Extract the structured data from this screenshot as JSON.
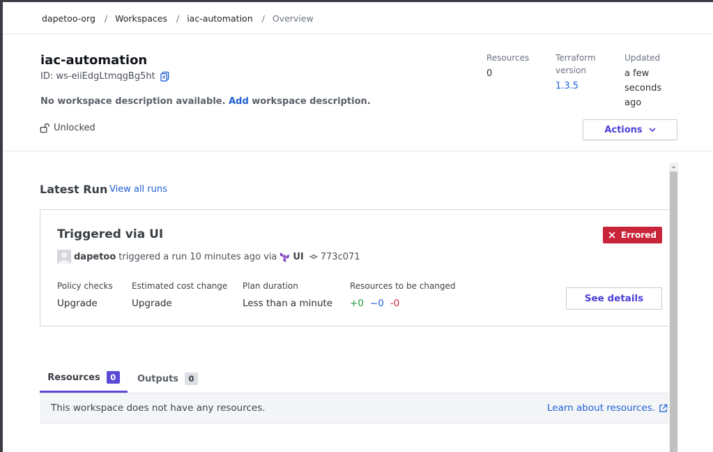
{
  "breadcrumb": {
    "org": "dapetoo-org",
    "workspaces": "Workspaces",
    "workspace": "iac-automation",
    "current": "Overview",
    "separator": "/"
  },
  "header": {
    "title": "iac-automation",
    "id_text": "ID: ws-eiiEdgLtmqgBg5ht",
    "description_prefix": "No workspace description available.",
    "description_link": "Add",
    "description_suffix": "workspace description.",
    "lock_status": "Unlocked",
    "actions_label": "Actions"
  },
  "stats": {
    "resources_label": "Resources",
    "resources_value": "0",
    "terraform_label_line1": "Terraform",
    "terraform_label_line2": "version",
    "terraform_value": "1.3.5",
    "updated_label": "Updated",
    "updated_line1": "a few",
    "updated_line2": "seconds",
    "updated_line3": "ago"
  },
  "latest_run": {
    "section_title": "Latest Run",
    "view_all": "View all runs",
    "run_title": "Triggered via UI",
    "status": "Errored",
    "status_color": "#c8243a",
    "user": "dapetoo",
    "triggered_text": "triggered a run 10 minutes ago via",
    "source": "UI",
    "commit": "773c071",
    "policy_label": "Policy checks",
    "policy_value": "Upgrade",
    "cost_label": "Estimated cost change",
    "cost_value": "Upgrade",
    "duration_label": "Plan duration",
    "duration_value": "Less than a minute",
    "resources_label": "Resources to be changed",
    "add_count": "+0",
    "change_count": "~0",
    "destroy_count": "-0",
    "details_button": "See details"
  },
  "tabs": [
    {
      "label": "Resources",
      "count": "0",
      "active": true
    },
    {
      "label": "Outputs",
      "count": "0",
      "active": false
    }
  ],
  "resources_panel": {
    "empty_text": "This workspace does not have any resources.",
    "learn_link": "Learn about resources."
  },
  "colors": {
    "accent": "#5a4ad6",
    "link": "#1f5fd6",
    "error": "#c8243a",
    "terraform": "#7b42bc"
  }
}
